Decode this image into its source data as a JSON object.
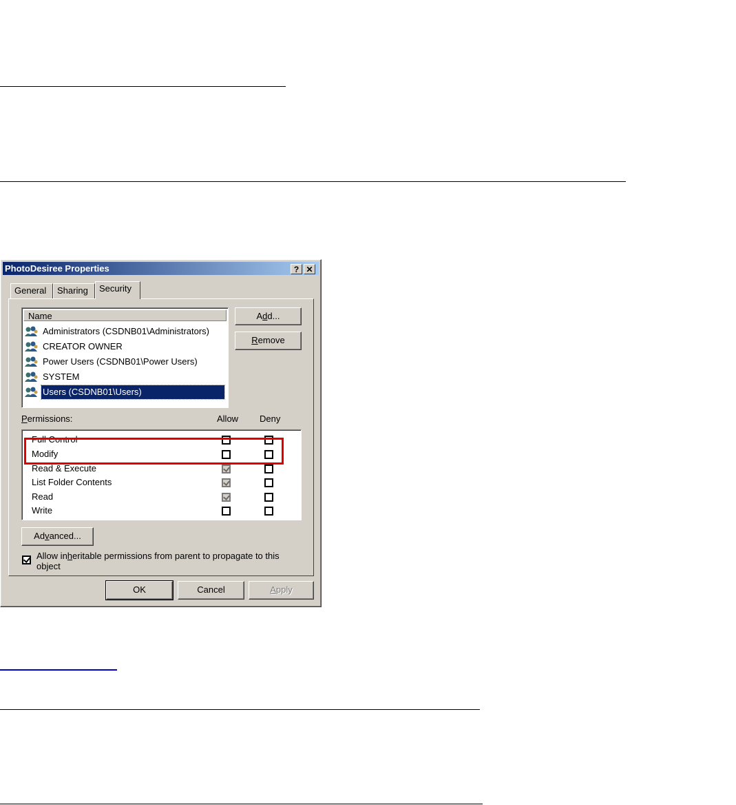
{
  "dialog": {
    "title": "PhotoDesiree Properties",
    "help_label": "?",
    "close_label": "✕",
    "tabs": [
      {
        "label": "General",
        "active": false
      },
      {
        "label": "Sharing",
        "active": false
      },
      {
        "label": "Security",
        "active": true
      }
    ],
    "users_list": {
      "column_header": "Name",
      "items": [
        {
          "label": "Administrators (CSDNB01\\Administrators)",
          "selected": false
        },
        {
          "label": "CREATOR OWNER",
          "selected": false
        },
        {
          "label": "Power Users (CSDNB01\\Power Users)",
          "selected": false
        },
        {
          "label": "SYSTEM",
          "selected": false
        },
        {
          "label": "Users (CSDNB01\\Users)",
          "selected": true
        }
      ]
    },
    "add_button": {
      "pre": "A",
      "accel": "d",
      "post": "d..."
    },
    "remove_button": {
      "pre": "",
      "accel": "R",
      "post": "emove"
    },
    "permissions": {
      "label_accel": "P",
      "label_rest": "ermissions:",
      "allow_header": "Allow",
      "deny_header": "Deny",
      "rows": [
        {
          "name": "Full Control",
          "allow": "unchecked",
          "deny": "unchecked"
        },
        {
          "name": "Modify",
          "allow": "unchecked",
          "deny": "unchecked"
        },
        {
          "name": "Read & Execute",
          "allow": "checked-grey",
          "deny": "unchecked"
        },
        {
          "name": "List Folder Contents",
          "allow": "checked-grey",
          "deny": "unchecked"
        },
        {
          "name": "Read",
          "allow": "checked-grey",
          "deny": "unchecked"
        },
        {
          "name": "Write",
          "allow": "unchecked",
          "deny": "unchecked"
        }
      ]
    },
    "advanced_button": {
      "pre": "Ad",
      "accel": "v",
      "post": "anced..."
    },
    "inherit": {
      "checked": true,
      "line1_pre": "Allow in",
      "line1_accel": "h",
      "line1_post": "eritable permissions from parent to propagate to this",
      "line2": "object"
    },
    "ok_label": "OK",
    "cancel_label": "Cancel",
    "apply_button": {
      "pre": "",
      "accel": "A",
      "post": "pply",
      "disabled": true
    }
  }
}
